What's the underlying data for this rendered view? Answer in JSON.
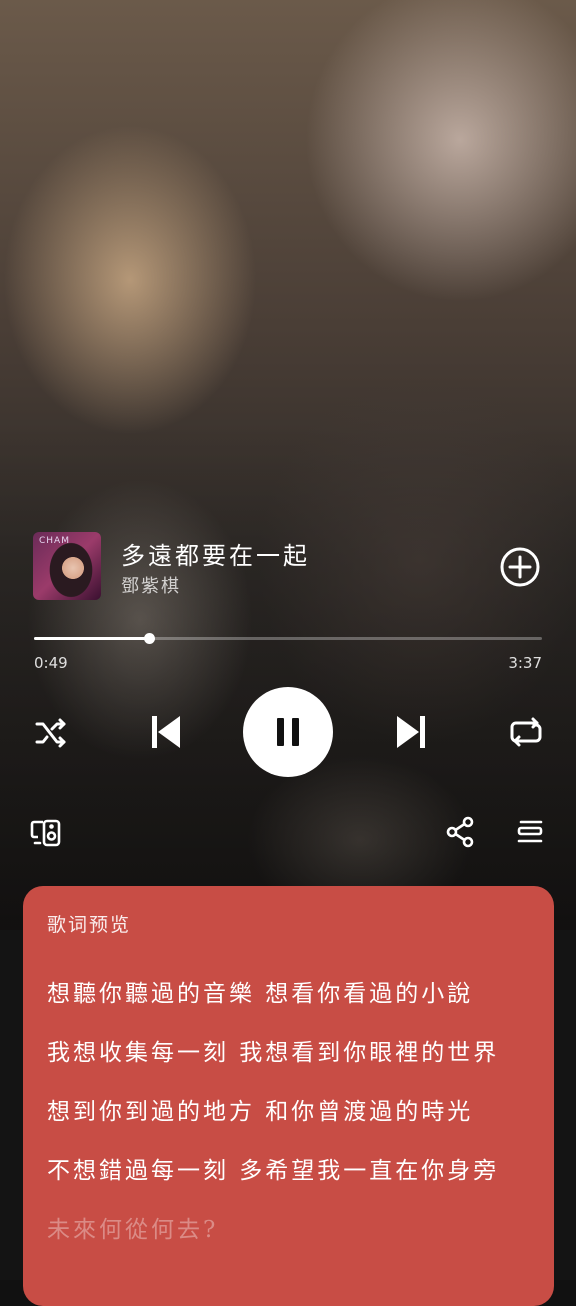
{
  "player": {
    "cover_text": "CHAM",
    "title": "多遠都要在一起",
    "artist": "鄧紫棋",
    "add_icon": "add-circle-icon",
    "progress_fraction": 0.227,
    "current_time": "0:49",
    "duration": "3:37",
    "controls": {
      "shuffle_icon": "shuffle-icon",
      "prev_icon": "skip-previous-icon",
      "play_icon": "pause-icon",
      "next_icon": "skip-next-icon",
      "repeat_icon": "repeat-icon"
    },
    "bottom_actions": {
      "device_icon": "device-speaker-icon",
      "share_icon": "share-icon",
      "queue_icon": "queue-list-icon"
    }
  },
  "lyrics": {
    "heading": "歌词预览",
    "lines": [
      "想聽你聽過的音樂 想看你看過的小說",
      "我想收集每一刻 我想看到你眼裡的世界",
      "想到你到過的地方 和你曾渡過的時光",
      "不想錯過每一刻 多希望我一直在你身旁",
      "未來何從何去?"
    ]
  },
  "colors": {
    "lyrics_card": "#c84d45",
    "accent": "#ffffff"
  }
}
